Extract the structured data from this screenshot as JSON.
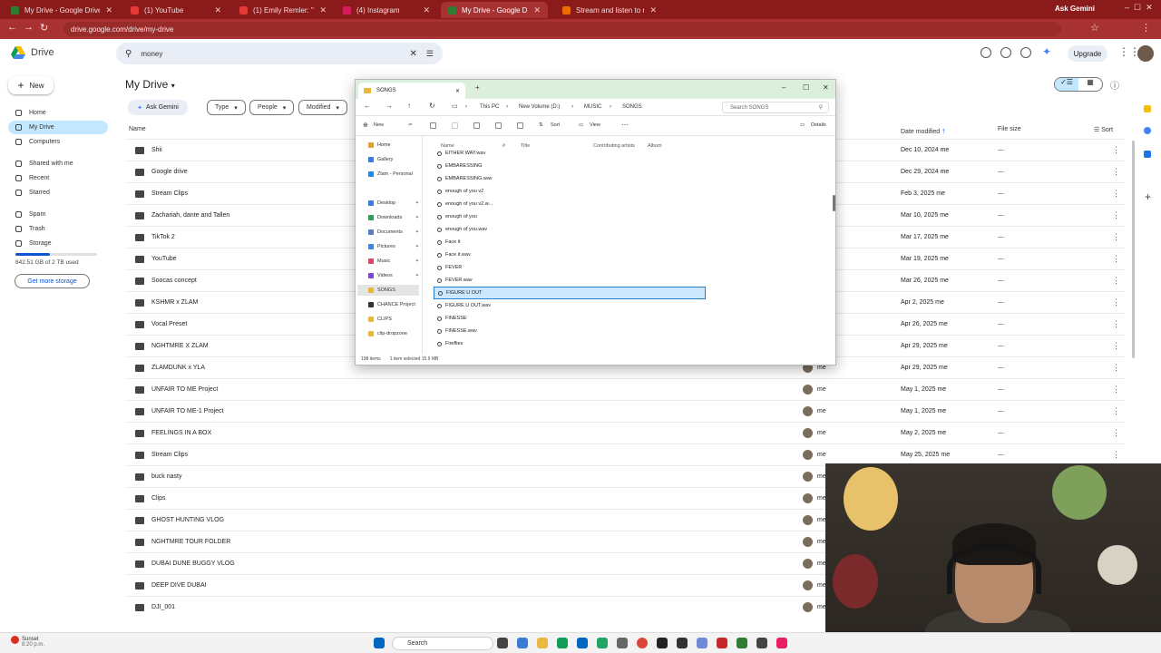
{
  "browser": {
    "tabs": [
      {
        "title": "My Drive - Google Drive",
        "active": false,
        "color": "#2e7d32"
      },
      {
        "title": "(1) YouTube",
        "active": false,
        "color": "#e53935"
      },
      {
        "title": "(1) Emily Remler: \"Around The",
        "active": false,
        "color": "#e53935"
      },
      {
        "title": "(4) Instagram",
        "active": false,
        "color": "#d81b60"
      },
      {
        "title": "My Drive - Google Drive",
        "active": true,
        "color": "#2e7d32"
      },
      {
        "title": "Stream and listen to music onli",
        "active": false,
        "color": "#ef6c00"
      }
    ],
    "ask_gemini": "Ask Gemini",
    "url": "drive.google.com/drive/my-drive"
  },
  "drive": {
    "logo_label": "Drive",
    "search_value": "money",
    "upgrade_label": "Upgrade",
    "new_label": "New",
    "sidebar": [
      {
        "label": "Home",
        "icon": "home-icon"
      },
      {
        "label": "My Drive",
        "icon": "drive-icon",
        "active": true
      },
      {
        "label": "Computers",
        "icon": "computer-icon"
      },
      {
        "label": "Shared with me",
        "icon": "shared-icon"
      },
      {
        "label": "Recent",
        "icon": "clock-icon"
      },
      {
        "label": "Starred",
        "icon": "star-icon"
      },
      {
        "label": "Spam",
        "icon": "spam-icon"
      },
      {
        "label": "Trash",
        "icon": "trash-icon"
      },
      {
        "label": "Storage",
        "icon": "cloud-icon"
      }
    ],
    "storage_text": "842.51 GB of 2 TB used",
    "storage_fraction": 0.42,
    "get_storage_label": "Get more storage",
    "page_title": "My Drive",
    "ask_gemini_label": "Ask Gemini",
    "filters": [
      "Type",
      "People",
      "Modified"
    ],
    "columns": {
      "name": "Name",
      "date": "Date modified",
      "size": "File size",
      "sort": "Sort"
    },
    "rows": [
      {
        "name": "Shii",
        "owner": "",
        "date": "Dec 10, 2024 me",
        "size": "—"
      },
      {
        "name": "Google drive",
        "owner": "",
        "date": "Dec 29, 2024 me",
        "size": "—"
      },
      {
        "name": "Stream Clips",
        "owner": "",
        "date": "Feb 3, 2025 me",
        "size": "—"
      },
      {
        "name": "Zachariah, dante and Tallen",
        "owner": "",
        "date": "Mar 10, 2025 me",
        "size": "—"
      },
      {
        "name": "TikTok 2",
        "owner": "",
        "date": "Mar 17, 2025 me",
        "size": "—"
      },
      {
        "name": "YouTube",
        "owner": "",
        "date": "Mar 19, 2025 me",
        "size": "—"
      },
      {
        "name": "Soocas concept",
        "owner": "",
        "date": "Mar 26, 2025 me",
        "size": "—"
      },
      {
        "name": "KSHMR x ZLAM",
        "owner": "",
        "date": "Apr 2, 2025 me",
        "size": "—"
      },
      {
        "name": "Vocal Preset",
        "owner": "",
        "date": "Apr 26, 2025 me",
        "size": "—"
      },
      {
        "name": "NGHTMRE X ZLAM",
        "owner": "",
        "date": "Apr 29, 2025 me",
        "size": "—"
      },
      {
        "name": "ZLAMDUNK x YLA",
        "owner": "me",
        "date": "Apr 29, 2025 me",
        "size": "—"
      },
      {
        "name": "UNFAIR TO ME Project",
        "owner": "me",
        "date": "May 1, 2025 me",
        "size": "—"
      },
      {
        "name": "UNFAIR TO ME-1 Project",
        "owner": "me",
        "date": "May 1, 2025 me",
        "size": "—"
      },
      {
        "name": "FEELINGS IN A BOX",
        "owner": "me",
        "date": "May 2, 2025 me",
        "size": "—"
      },
      {
        "name": "Stream Clips",
        "owner": "me",
        "date": "May 25, 2025 me",
        "size": "—"
      },
      {
        "name": "buck nasty",
        "owner": "me",
        "date": "",
        "size": ""
      },
      {
        "name": "Clips",
        "owner": "me",
        "date": "",
        "size": ""
      },
      {
        "name": "GHOST HUNTING VLOG",
        "owner": "me",
        "date": "",
        "size": ""
      },
      {
        "name": "NGHTMRE TOUR FOLDER",
        "owner": "me",
        "date": "",
        "size": ""
      },
      {
        "name": "DUBAI DUNE BUGGY VLOG",
        "owner": "me",
        "date": "",
        "size": ""
      },
      {
        "name": "DEEP DIVE DUBAI",
        "owner": "me",
        "date": "",
        "size": ""
      },
      {
        "name": "DJI_001",
        "owner": "me",
        "date": "",
        "size": ""
      }
    ]
  },
  "explorer": {
    "tab_title": "SONGS",
    "breadcrumb": [
      "This PC",
      "New Volume (D:)",
      "MUSIC",
      "SONGS"
    ],
    "search_placeholder": "Search SONGS",
    "toolbar": {
      "new": "New",
      "sort": "Sort",
      "view": "View",
      "details": "Details"
    },
    "nav": [
      {
        "label": "Home",
        "color": "#e0a030"
      },
      {
        "label": "Gallery",
        "color": "#3a7bd5"
      },
      {
        "label": "Zlam - Personal",
        "color": "#1e88e5"
      },
      {
        "label": "Desktop",
        "color": "#3a7bd5",
        "pinned": true
      },
      {
        "label": "Downloads",
        "color": "#2e9d5a",
        "pinned": true
      },
      {
        "label": "Documents",
        "color": "#5a7bbd",
        "pinned": true
      },
      {
        "label": "Pictures",
        "color": "#3a8ad5",
        "pinned": true
      },
      {
        "label": "Music",
        "color": "#d84a6a",
        "pinned": true
      },
      {
        "label": "Videos",
        "color": "#7a4ad5",
        "pinned": true
      },
      {
        "label": "SONGS",
        "color": "#e8b840",
        "selected": true
      },
      {
        "label": "CHANCE Project",
        "color": "#333333"
      },
      {
        "label": "CLIPS",
        "color": "#e8b840"
      },
      {
        "label": "clip-dropzone",
        "color": "#e8b840"
      }
    ],
    "list_headers": [
      "Name",
      "#",
      "Title",
      "Contributing artists",
      "Album"
    ],
    "files": [
      {
        "name": "EITHER WAY.wav"
      },
      {
        "name": "EMBARESSING"
      },
      {
        "name": "EMBARESSING.wav"
      },
      {
        "name": "enough of you v2"
      },
      {
        "name": "enough of you v2.w..."
      },
      {
        "name": "enough of you"
      },
      {
        "name": "enough of you.wav"
      },
      {
        "name": "Face it"
      },
      {
        "name": "Face it.wav"
      },
      {
        "name": "FEVER"
      },
      {
        "name": "FEVER.wav"
      },
      {
        "name": "FIGURE U OUT",
        "selected": true
      },
      {
        "name": "FIGURE U OUT.wav"
      },
      {
        "name": "FINESSE"
      },
      {
        "name": "FINESSE.wav"
      },
      {
        "name": "Fireflies"
      }
    ],
    "status": {
      "count": "198 items",
      "selected": "1 item selected  15.9 MB"
    }
  },
  "taskbar": {
    "weather_title": "Sunset",
    "weather_time": "8:20 p.m.",
    "search_label": "Search"
  }
}
